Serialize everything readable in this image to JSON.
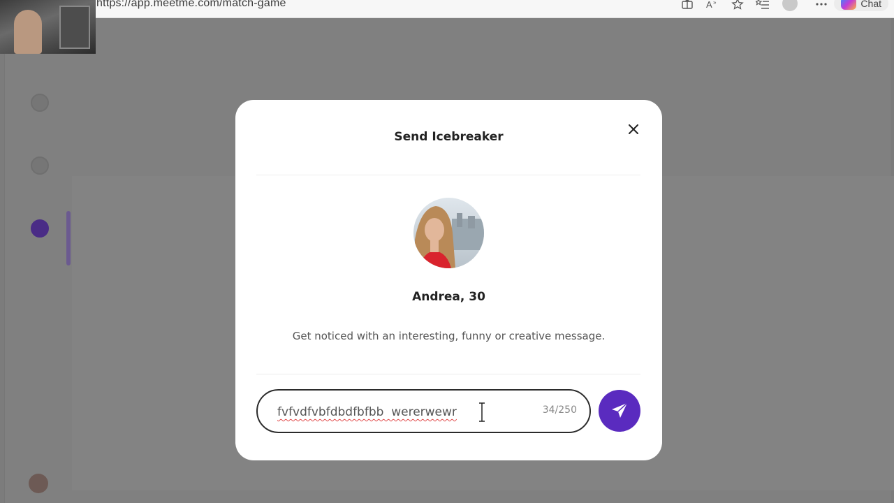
{
  "browser": {
    "url": "https://app.meetme.com/match-game",
    "icons": [
      "extensions-icon",
      "read-aloud-icon",
      "favorite-star-icon",
      "favorites-list-icon"
    ],
    "copilot_label": "Chat"
  },
  "background": {
    "nav_items": [
      {
        "icon": "browse-icon",
        "active": false
      },
      {
        "icon": "live-icon",
        "active": false
      },
      {
        "icon": "match-icon",
        "active": true
      },
      {
        "icon": "chat-icon",
        "active": false
      }
    ]
  },
  "modal": {
    "title": "Send Icebreaker",
    "close_icon": "close-icon",
    "profile": {
      "name": "Andrea, 30"
    },
    "hint": "Get noticed with an interesting, funny or creative message.",
    "message": {
      "value": "fvfvdfvbfdbdfbfbb  wererwewr",
      "counter": "34/250"
    },
    "send_icon": "send-icon"
  },
  "colors": {
    "accent": "#5a2bbf",
    "overlay": "#808080",
    "modal_bg": "#ffffff",
    "spellcheck": "#e24b4b"
  }
}
